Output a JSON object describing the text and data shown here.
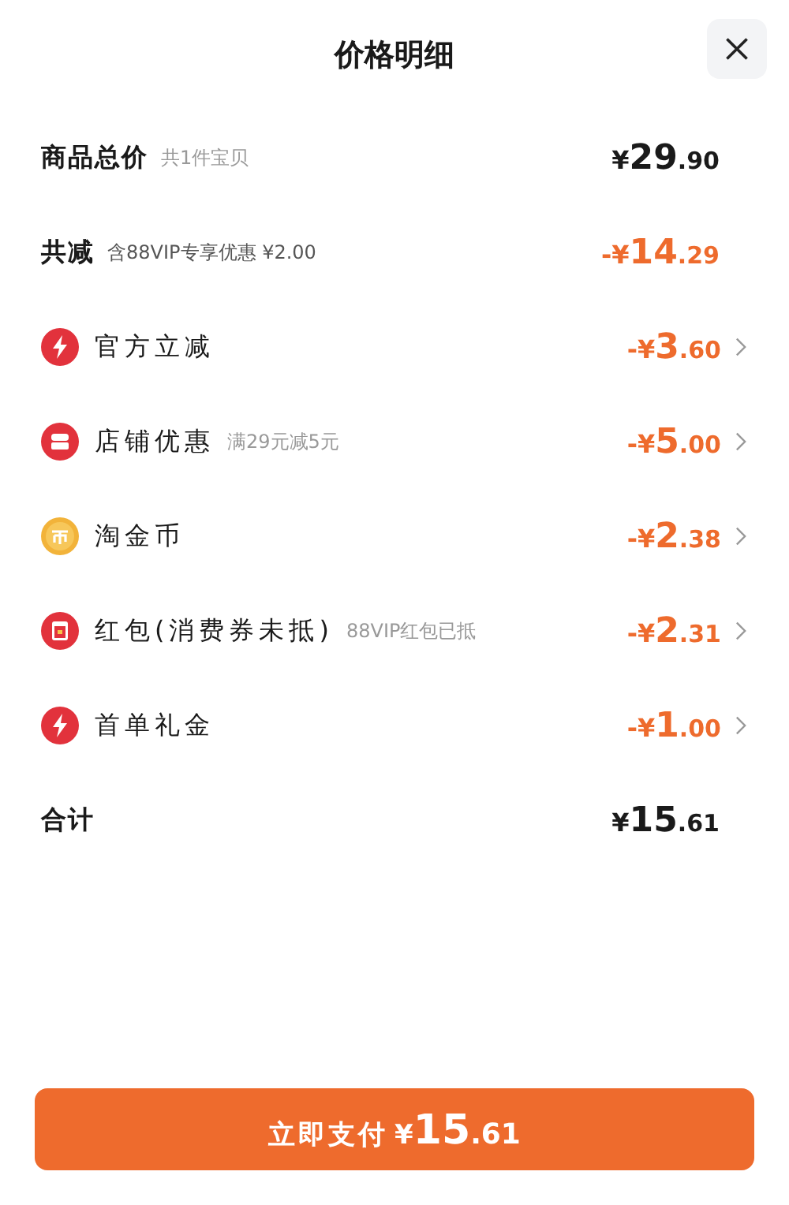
{
  "header": {
    "title": "价格明细"
  },
  "rows": [
    {
      "kind": "total",
      "label": "商品总价",
      "note": "共1件宝贝",
      "amount": "¥29.90",
      "chevron": false
    },
    {
      "kind": "reduction",
      "label": "共减",
      "note": "含88VIP专享优惠 ¥2.00",
      "amount": "-¥14.29",
      "chevron": false
    },
    {
      "kind": "lightning",
      "label": "官方立减",
      "amount": "-¥3.60",
      "chevron": true
    },
    {
      "kind": "store",
      "label": "店铺优惠",
      "note": "满29元减5元",
      "amount": "-¥5.00",
      "chevron": true
    },
    {
      "kind": "coin",
      "label": "淘金币",
      "amount": "-¥2.38",
      "chevron": true
    },
    {
      "kind": "envelope",
      "label": "红包(消费券未抵)",
      "note": "88VIP红包已抵",
      "amount": "-¥2.31",
      "chevron": true
    },
    {
      "kind": "lightning",
      "label": "首单礼金",
      "amount": "-¥1.00",
      "chevron": true
    },
    {
      "kind": "total",
      "label": "合计",
      "amount": "¥15.61",
      "chevron": false
    }
  ],
  "pay_button": {
    "label": "立即支付",
    "amount": "¥15.61"
  }
}
